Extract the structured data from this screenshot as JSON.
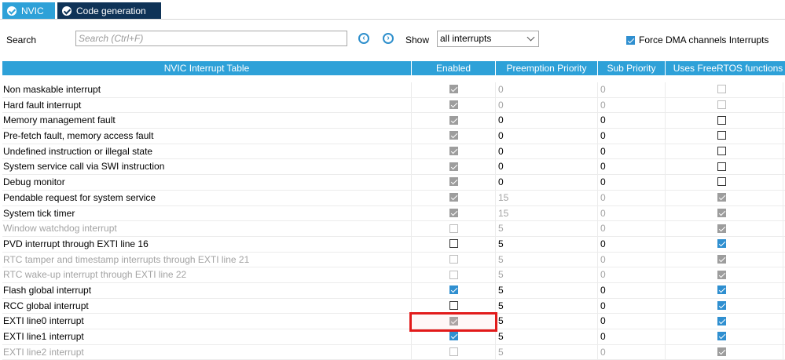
{
  "tabs": [
    {
      "label": "NVIC"
    },
    {
      "label": "Code generation"
    }
  ],
  "toolbar": {
    "search_label": "Search",
    "search_placeholder": "Search (Ctrl+F)",
    "show_label": "Show",
    "show_value": "all interrupts",
    "force_dma_label": "Force DMA channels Interrupts",
    "force_dma_checked": true
  },
  "table": {
    "columns": [
      "NVIC Interrupt Table",
      "Enabled",
      "Preemption Priority",
      "Sub Priority",
      "Uses FreeRTOS functions"
    ],
    "rows": [
      {
        "name": "Non maskable interrupt",
        "enabled": "gray-on",
        "preempt": "0",
        "sub": "0",
        "freertos": "gray-off",
        "disabled": false,
        "prio_dim": true
      },
      {
        "name": "Hard fault interrupt",
        "enabled": "gray-on",
        "preempt": "0",
        "sub": "0",
        "freertos": "gray-off",
        "disabled": false,
        "prio_dim": true
      },
      {
        "name": "Memory management fault",
        "enabled": "gray-on",
        "preempt": "0",
        "sub": "0",
        "freertos": "off",
        "disabled": false,
        "prio_dim": false
      },
      {
        "name": "Pre-fetch fault, memory access fault",
        "enabled": "gray-on",
        "preempt": "0",
        "sub": "0",
        "freertos": "off",
        "disabled": false,
        "prio_dim": false
      },
      {
        "name": "Undefined instruction or illegal state",
        "enabled": "gray-on",
        "preempt": "0",
        "sub": "0",
        "freertos": "off",
        "disabled": false,
        "prio_dim": false
      },
      {
        "name": "System service call via SWI instruction",
        "enabled": "gray-on",
        "preempt": "0",
        "sub": "0",
        "freertos": "off",
        "disabled": false,
        "prio_dim": false
      },
      {
        "name": "Debug monitor",
        "enabled": "gray-on",
        "preempt": "0",
        "sub": "0",
        "freertos": "off",
        "disabled": false,
        "prio_dim": false
      },
      {
        "name": "Pendable request for system service",
        "enabled": "gray-on",
        "preempt": "15",
        "sub": "0",
        "freertos": "gray-on",
        "disabled": false,
        "prio_dim": true
      },
      {
        "name": "System tick timer",
        "enabled": "gray-on",
        "preempt": "15",
        "sub": "0",
        "freertos": "gray-on",
        "disabled": false,
        "prio_dim": true
      },
      {
        "name": "Window watchdog interrupt",
        "enabled": "gray-off",
        "preempt": "5",
        "sub": "0",
        "freertos": "gray-on",
        "disabled": true,
        "prio_dim": true
      },
      {
        "name": "PVD interrupt through EXTI line 16",
        "enabled": "off",
        "preempt": "5",
        "sub": "0",
        "freertos": "on",
        "disabled": false,
        "prio_dim": false
      },
      {
        "name": "RTC tamper and timestamp interrupts through EXTI line 21",
        "enabled": "gray-off",
        "preempt": "5",
        "sub": "0",
        "freertos": "gray-on",
        "disabled": true,
        "prio_dim": true
      },
      {
        "name": "RTC wake-up interrupt through EXTI line 22",
        "enabled": "gray-off",
        "preempt": "5",
        "sub": "0",
        "freertos": "gray-on",
        "disabled": true,
        "prio_dim": true
      },
      {
        "name": "Flash global interrupt",
        "enabled": "on",
        "preempt": "5",
        "sub": "0",
        "freertos": "on",
        "disabled": false,
        "prio_dim": false
      },
      {
        "name": "RCC global interrupt",
        "enabled": "off",
        "preempt": "5",
        "sub": "0",
        "freertos": "on",
        "disabled": false,
        "prio_dim": false
      },
      {
        "name": "EXTI line0 interrupt",
        "enabled": "gray-on",
        "preempt": "5",
        "sub": "0",
        "freertos": "on",
        "disabled": false,
        "prio_dim": false
      },
      {
        "name": "EXTI line1 interrupt",
        "enabled": "on",
        "preempt": "5",
        "sub": "0",
        "freertos": "on",
        "disabled": false,
        "prio_dim": false
      },
      {
        "name": "EXTI line2 interrupt",
        "enabled": "gray-off",
        "preempt": "5",
        "sub": "0",
        "freertos": "gray-on",
        "disabled": true,
        "prio_dim": true
      }
    ]
  },
  "colors": {
    "tab_active": "#2ea1d8",
    "tab_inactive": "#0f3357",
    "header_bg": "#2ea1d8",
    "checkbox_blue": "#2f8fd0",
    "highlight_red": "#e21a1a"
  }
}
